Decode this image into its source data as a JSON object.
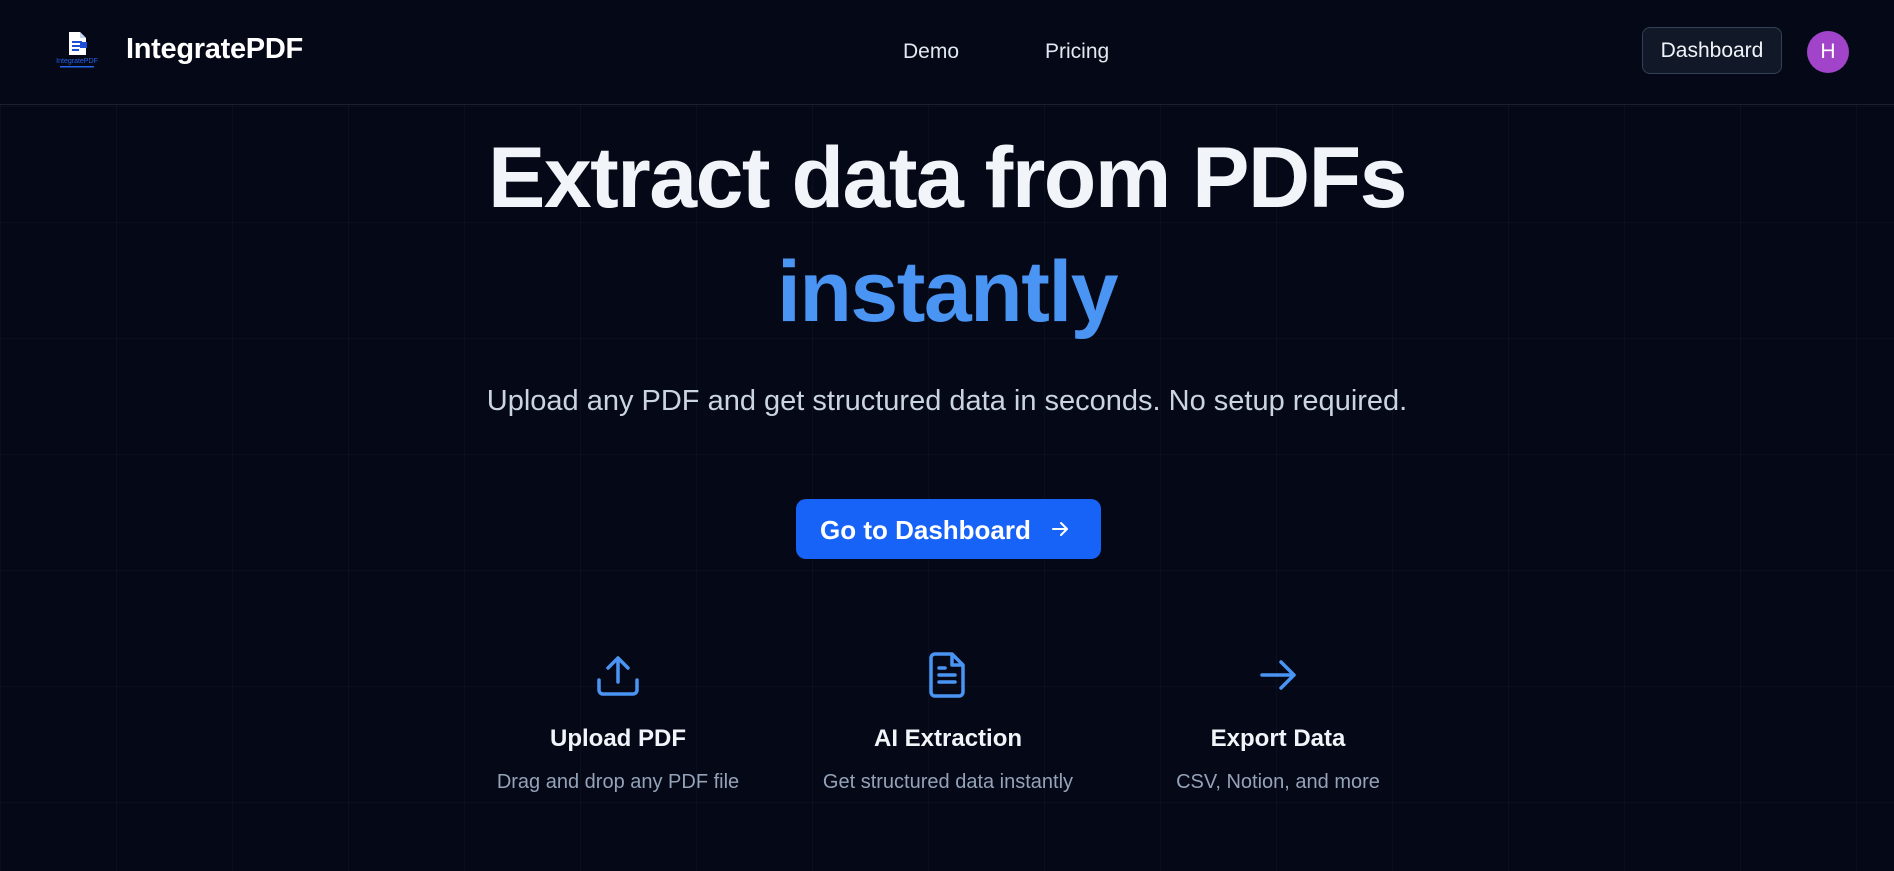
{
  "navbar": {
    "brand": "IntegratePDF",
    "logo_text": "IntegratePDF",
    "links": [
      "Demo",
      "Pricing"
    ],
    "dashboard_button": "Dashboard",
    "avatar_initial": "H"
  },
  "hero": {
    "title": "Extract data from PDFs",
    "title_accent": "instantly",
    "subtitle": "Upload any PDF and get structured data in seconds. No setup required.",
    "cta_label": "Go to Dashboard",
    "cta_icon": "arrow-right-icon"
  },
  "features": [
    {
      "icon": "upload-icon",
      "title": "Upload PDF",
      "description": "Drag and drop any PDF file"
    },
    {
      "icon": "document-icon",
      "title": "AI Extraction",
      "description": "Get structured data instantly"
    },
    {
      "icon": "arrow-right-icon",
      "title": "Export Data",
      "description": "CSV, Notion, and more"
    }
  ],
  "colors": {
    "background": "#050816",
    "accent": "#4a95f3",
    "cta": "#1763f7",
    "avatar": "#a244c9"
  }
}
